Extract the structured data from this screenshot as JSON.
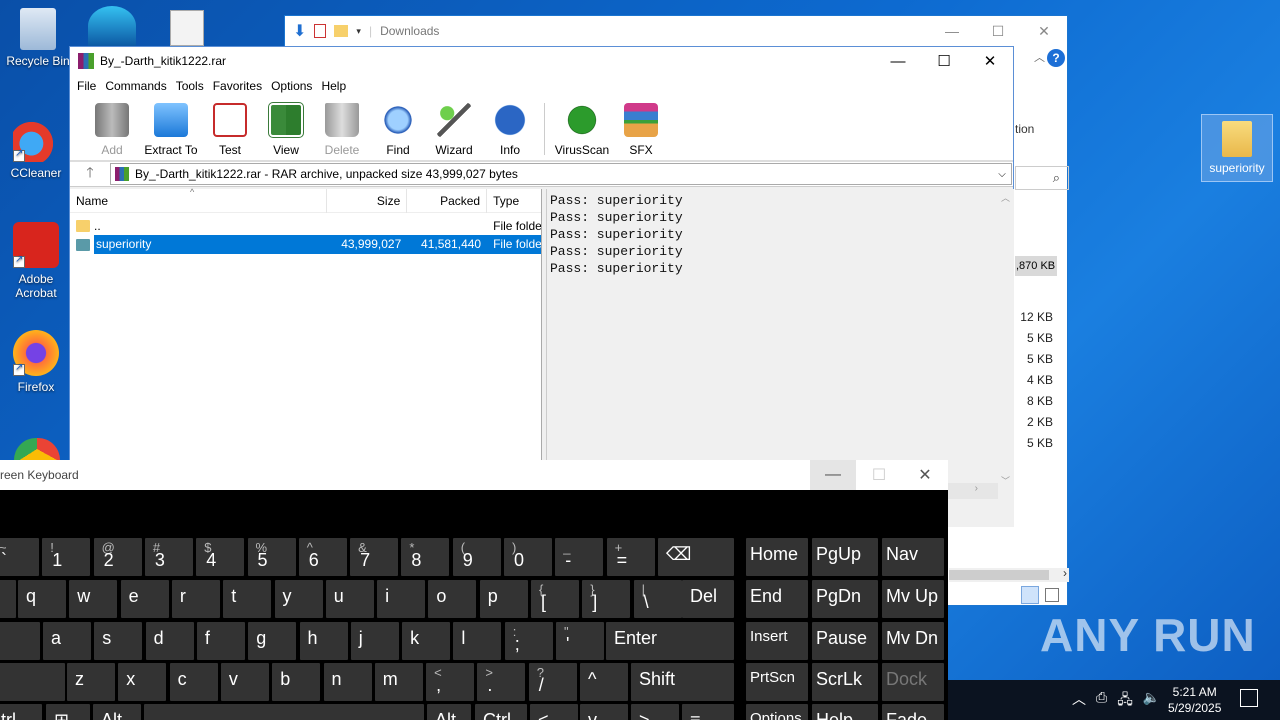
{
  "desktop": {
    "icons": [
      {
        "label": "Recycle Bin",
        "icon": "recycle-bin-icon"
      },
      {
        "label": "CCleaner",
        "icon": "ccleaner-icon"
      },
      {
        "label": "Adobe Acrobat",
        "icon": "acrobat-icon"
      },
      {
        "label": "Firefox",
        "icon": "firefox-icon"
      }
    ],
    "folder_label": "superiority"
  },
  "explorer": {
    "title": "Downloads",
    "frag_label": "tion",
    "size_badge": ",870 KB",
    "sizes": [
      "12 KB",
      "5 KB",
      "5 KB",
      "4 KB",
      "8 KB",
      "2 KB",
      "5 KB"
    ]
  },
  "winrar": {
    "title": "By_-Darth_kitik1222.rar",
    "menu": [
      "File",
      "Commands",
      "Tools",
      "Favorites",
      "Options",
      "Help"
    ],
    "toolbar": [
      {
        "label": "Add",
        "icon": "add-icon",
        "disabled": true
      },
      {
        "label": "Extract To",
        "icon": "extract-icon",
        "disabled": false
      },
      {
        "label": "Test",
        "icon": "test-icon",
        "disabled": false
      },
      {
        "label": "View",
        "icon": "view-icon",
        "disabled": false
      },
      {
        "label": "Delete",
        "icon": "delete-icon",
        "disabled": true
      },
      {
        "label": "Find",
        "icon": "find-icon",
        "disabled": false
      },
      {
        "label": "Wizard",
        "icon": "wizard-icon",
        "disabled": false
      },
      {
        "label": "Info",
        "icon": "info-icon",
        "disabled": false
      },
      {
        "label": "VirusScan",
        "icon": "virusscan-icon",
        "disabled": false
      },
      {
        "label": "SFX",
        "icon": "sfx-icon",
        "disabled": false
      }
    ],
    "address": "By_-Darth_kitik1222.rar - RAR archive, unpacked size 43,999,027 bytes",
    "columns": {
      "name": "Name",
      "size": "Size",
      "packed": "Packed",
      "type": "Type"
    },
    "rows": [
      {
        "name": "..",
        "size": "",
        "packed": "",
        "type": "File folde",
        "selected": false
      },
      {
        "name": "superiority",
        "size": "43,999,027",
        "packed": "41,581,440",
        "type": "File folde",
        "selected": true
      }
    ],
    "comment": "Pass: superiority\nPass: superiority\nPass: superiority\nPass: superiority\nPass: superiority"
  },
  "osk": {
    "title": "reen Keyboard",
    "rows": [
      [
        {
          "sub": "~",
          "main": "`"
        },
        {
          "sub": "!",
          "main": "1"
        },
        {
          "sub": "@",
          "main": "2"
        },
        {
          "sub": "#",
          "main": "3"
        },
        {
          "sub": "$",
          "main": "4"
        },
        {
          "sub": "%",
          "main": "5"
        },
        {
          "sub": "^",
          "main": "6"
        },
        {
          "sub": "&",
          "main": "7"
        },
        {
          "sub": "*",
          "main": "8"
        },
        {
          "sub": "(",
          "main": "9"
        },
        {
          "sub": ")",
          "main": "0"
        },
        {
          "sub": "_",
          "main": "-"
        },
        {
          "sub": "+",
          "main": "="
        }
      ],
      [
        {
          "main": "q"
        },
        {
          "main": "w"
        },
        {
          "main": "e"
        },
        {
          "main": "r"
        },
        {
          "main": "t"
        },
        {
          "main": "y"
        },
        {
          "main": "u"
        },
        {
          "main": "i"
        },
        {
          "main": "o"
        },
        {
          "main": "p"
        },
        {
          "sub": "{",
          "main": "["
        },
        {
          "sub": "}",
          "main": "]"
        },
        {
          "sub": "|",
          "main": "\\"
        }
      ],
      [
        {
          "main": "a"
        },
        {
          "main": "s"
        },
        {
          "main": "d"
        },
        {
          "main": "f"
        },
        {
          "main": "g"
        },
        {
          "main": "h"
        },
        {
          "main": "j"
        },
        {
          "main": "k"
        },
        {
          "main": "l"
        },
        {
          "sub": ":",
          "main": ";"
        },
        {
          "sub": "\"",
          "main": "'"
        }
      ],
      [
        {
          "main": "z"
        },
        {
          "main": "x"
        },
        {
          "main": "c"
        },
        {
          "main": "v"
        },
        {
          "main": "b"
        },
        {
          "main": "n"
        },
        {
          "main": "m"
        },
        {
          "sub": "<",
          "main": ","
        },
        {
          "sub": ">",
          "main": "."
        },
        {
          "sub": "?",
          "main": "/"
        }
      ]
    ],
    "special": {
      "del": "Del",
      "enter": "Enter",
      "shift": "Shift",
      "ctrl": "Ctrl",
      "alt": "Alt",
      "nav": [
        "Home",
        "PgUp",
        "Nav",
        "End",
        "PgDn",
        "Mv Up",
        "Insert",
        "Pause",
        "Mv Dn",
        "PrtScn",
        "ScrLk",
        "Dock",
        "Options",
        "Help",
        "Fade"
      ]
    }
  },
  "taskbar": {
    "time": "5:21 AM",
    "date": "5/29/2025"
  },
  "watermark": "ANY RUN"
}
